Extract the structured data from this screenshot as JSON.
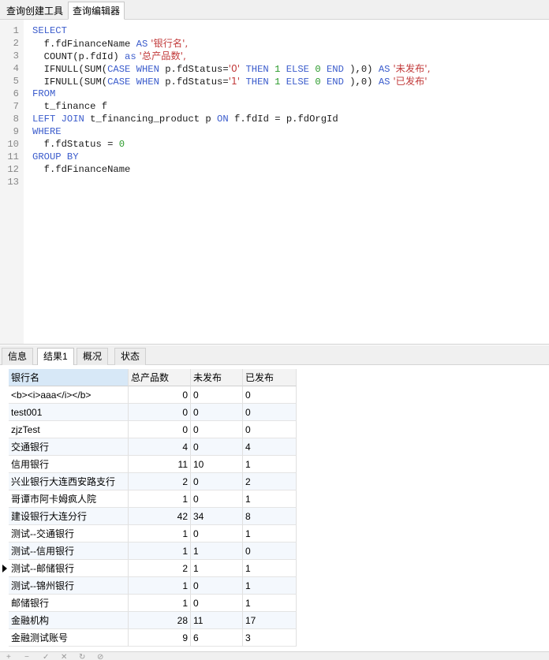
{
  "top_tabs": [
    "查询创建工具",
    "查询编辑器"
  ],
  "editor": {
    "lines": [
      {
        "n": "1",
        "tokens": [
          {
            "t": "SELECT",
            "c": "kw"
          }
        ]
      },
      {
        "n": "2",
        "tokens": [
          {
            "t": "  f.fdFinanceName ",
            "c": ""
          },
          {
            "t": "AS",
            "c": "kw"
          },
          {
            "t": " '银行名',",
            "c": "str"
          }
        ]
      },
      {
        "n": "3",
        "tokens": [
          {
            "t": "  COUNT(p.fdId) ",
            "c": ""
          },
          {
            "t": "as",
            "c": "kw"
          },
          {
            "t": " '总产品数',",
            "c": "str"
          }
        ]
      },
      {
        "n": "4",
        "tokens": [
          {
            "t": "  IFNULL(SUM(",
            "c": ""
          },
          {
            "t": "CASE WHEN",
            "c": "kw"
          },
          {
            "t": " p.fdStatus=",
            "c": ""
          },
          {
            "t": "'0'",
            "c": "str"
          },
          {
            "t": " ",
            "c": ""
          },
          {
            "t": "THEN",
            "c": "kw"
          },
          {
            "t": " ",
            "c": ""
          },
          {
            "t": "1",
            "c": "num"
          },
          {
            "t": " ",
            "c": ""
          },
          {
            "t": "ELSE",
            "c": "kw"
          },
          {
            "t": " ",
            "c": ""
          },
          {
            "t": "0",
            "c": "num"
          },
          {
            "t": " ",
            "c": ""
          },
          {
            "t": "END",
            "c": "kw"
          },
          {
            "t": " ),0) ",
            "c": ""
          },
          {
            "t": "AS",
            "c": "kw"
          },
          {
            "t": " '未发布',",
            "c": "str"
          }
        ]
      },
      {
        "n": "5",
        "tokens": [
          {
            "t": "  IFNULL(SUM(",
            "c": ""
          },
          {
            "t": "CASE WHEN",
            "c": "kw"
          },
          {
            "t": " p.fdStatus=",
            "c": ""
          },
          {
            "t": "'1'",
            "c": "str"
          },
          {
            "t": " ",
            "c": ""
          },
          {
            "t": "THEN",
            "c": "kw"
          },
          {
            "t": " ",
            "c": ""
          },
          {
            "t": "1",
            "c": "num"
          },
          {
            "t": " ",
            "c": ""
          },
          {
            "t": "ELSE",
            "c": "kw"
          },
          {
            "t": " ",
            "c": ""
          },
          {
            "t": "0",
            "c": "num"
          },
          {
            "t": " ",
            "c": ""
          },
          {
            "t": "END",
            "c": "kw"
          },
          {
            "t": " ),0) ",
            "c": ""
          },
          {
            "t": "AS",
            "c": "kw"
          },
          {
            "t": " '已发布'",
            "c": "str"
          }
        ]
      },
      {
        "n": "6",
        "tokens": [
          {
            "t": "FROM",
            "c": "kw"
          }
        ]
      },
      {
        "n": "7",
        "tokens": [
          {
            "t": "  t_finance f",
            "c": ""
          }
        ]
      },
      {
        "n": "8",
        "tokens": [
          {
            "t": "LEFT JOIN",
            "c": "kw"
          },
          {
            "t": " t_financing_product p ",
            "c": ""
          },
          {
            "t": "ON",
            "c": "kw"
          },
          {
            "t": " f.fdId = p.fdOrgId",
            "c": ""
          }
        ]
      },
      {
        "n": "9",
        "tokens": [
          {
            "t": "WHERE",
            "c": "kw"
          }
        ]
      },
      {
        "n": "10",
        "tokens": [
          {
            "t": "  f.fdStatus = ",
            "c": ""
          },
          {
            "t": "0",
            "c": "num"
          }
        ]
      },
      {
        "n": "11",
        "tokens": [
          {
            "t": "GROUP BY",
            "c": "kw"
          }
        ]
      },
      {
        "n": "12",
        "tokens": [
          {
            "t": "  f.fdFinanceName",
            "c": ""
          }
        ]
      },
      {
        "n": "13",
        "tokens": []
      }
    ]
  },
  "bottom_tabs": [
    "信息",
    "结果1",
    "概况",
    "状态"
  ],
  "result": {
    "columns": [
      "银行名",
      "总产品数",
      "未发布",
      "已发布"
    ],
    "rows": [
      [
        "<b><i>aaa</i></b>",
        "0",
        "0",
        "0"
      ],
      [
        "test001",
        "0",
        "0",
        "0"
      ],
      [
        "zjzTest",
        "0",
        "0",
        "0"
      ],
      [
        "交通银行",
        "4",
        "0",
        "4"
      ],
      [
        "信用银行",
        "11",
        "10",
        "1"
      ],
      [
        "兴业银行大连西安路支行",
        "2",
        "0",
        "2"
      ],
      [
        "哥谭市阿卡姆疯人院",
        "1",
        "0",
        "1"
      ],
      [
        "建设银行大连分行",
        "42",
        "34",
        "8"
      ],
      [
        "测试--交通银行",
        "1",
        "0",
        "1"
      ],
      [
        "测试--信用银行",
        "1",
        "1",
        "0"
      ],
      [
        "测试--邮储银行",
        "2",
        "1",
        "1"
      ],
      [
        "测试--锦州银行",
        "1",
        "0",
        "1"
      ],
      [
        "邮储银行",
        "1",
        "0",
        "1"
      ],
      [
        "金融机构",
        "28",
        "11",
        "17"
      ],
      [
        "金融测试账号",
        "9",
        "6",
        "3"
      ]
    ],
    "current_row": 10
  },
  "toolbar_icons": [
    "add-record-icon",
    "delete-record-icon",
    "apply-icon",
    "cancel-icon",
    "refresh-icon",
    "stop-icon"
  ],
  "toolbar_glyphs": [
    "+",
    "−",
    "✓",
    "✕",
    "↻",
    "⊘"
  ]
}
